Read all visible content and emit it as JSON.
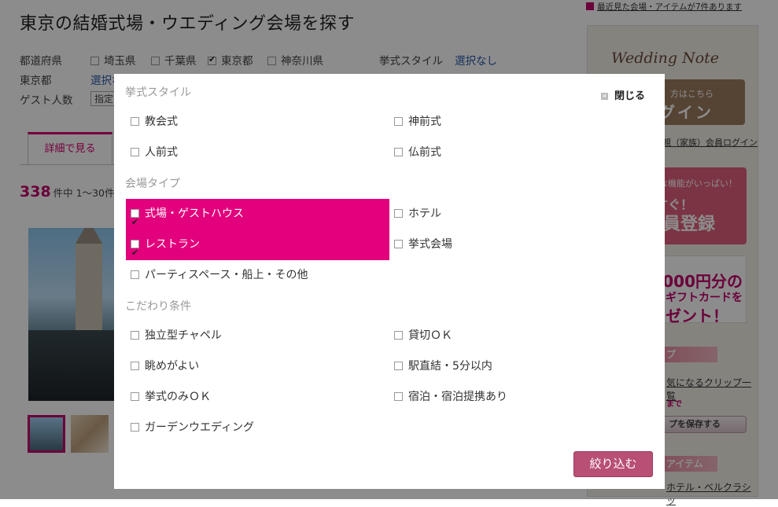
{
  "header": {
    "title": "東京の結婚式場・ウエディング会場を探す"
  },
  "filters": {
    "prefecture_label": "都道府県",
    "prefectures": [
      {
        "label": "埼玉県",
        "checked": false
      },
      {
        "label": "千葉県",
        "checked": false
      },
      {
        "label": "東京都",
        "checked": true
      },
      {
        "label": "神奈川県",
        "checked": false
      }
    ],
    "city_label": "東京都",
    "city_value": "選択な",
    "guests_label": "ゲスト人数",
    "guests_value": "指定",
    "style_label": "挙式スタイル",
    "style_value": "選択なし"
  },
  "tabs": {
    "detail": "詳細で見る"
  },
  "results": {
    "count": "338",
    "suffix": "件中 1〜30件"
  },
  "sidebar": {
    "recent_note": "最近見た会場・アイテムが7件あります",
    "wn_title": "Wedding Note",
    "login_small": "方はこちら",
    "login_big": "グイン",
    "parent_login": "親（家族）会員ログイン",
    "reg_a": "な機能がいっぱい！",
    "reg_b": "すぐ！",
    "reg_c": "員登録",
    "gift_a": "0,000円分の",
    "gift_b": "Bギフトカードを",
    "gift_c": "レゼント！",
    "clip_bar": "プ",
    "clip_link": "気になるクリップ一覧",
    "clip_note": "まで",
    "save_btn": "プを保存する",
    "item_bar": "アイテム",
    "item_link": "ホテル・ベルクラシッ"
  },
  "modal": {
    "close_label": "閉じる",
    "sections": {
      "style": "挙式スタイル",
      "venue": "会場タイプ",
      "feature": "こだわり条件"
    },
    "style_options": [
      {
        "label": "教会式",
        "checked": false
      },
      {
        "label": "神前式",
        "checked": false
      },
      {
        "label": "人前式",
        "checked": false
      },
      {
        "label": "仏前式",
        "checked": false
      }
    ],
    "venue_options": [
      {
        "label": "式場・ゲストハウス",
        "checked": true
      },
      {
        "label": "ホテル",
        "checked": false
      },
      {
        "label": "レストラン",
        "checked": true
      },
      {
        "label": "挙式会場",
        "checked": false
      },
      {
        "label": "パーティスペース・船上・その他",
        "checked": false
      }
    ],
    "feature_options": [
      {
        "label": "独立型チャペル",
        "checked": false
      },
      {
        "label": "貸切ＯＫ",
        "checked": false
      },
      {
        "label": "眺めがよい",
        "checked": false
      },
      {
        "label": "駅直結・5分以内",
        "checked": false
      },
      {
        "label": "挙式のみＯＫ",
        "checked": false
      },
      {
        "label": "宿泊・宿泊提携あり",
        "checked": false
      },
      {
        "label": "ガーデンウエディング",
        "checked": false
      }
    ],
    "filter_button": "絞り込む"
  },
  "colors": {
    "accent": "#e3007c",
    "button": "#b84f75"
  }
}
